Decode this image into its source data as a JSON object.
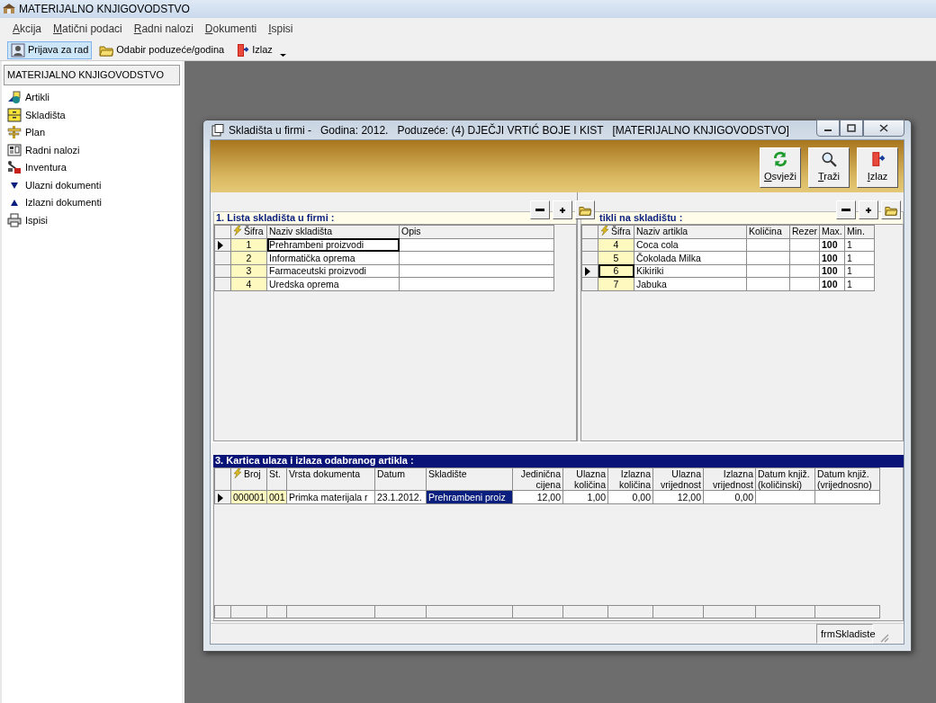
{
  "app": {
    "title": "MATERIJALNO KNJIGOVODSTVO"
  },
  "menu": [
    {
      "label": "Akcija"
    },
    {
      "label": "Matični podaci"
    },
    {
      "label": "Radni nalozi"
    },
    {
      "label": "Dokumenti"
    },
    {
      "label": "Ispisi"
    }
  ],
  "toolbar": [
    {
      "label": "Prijava za rad",
      "kind": "login",
      "selected": true
    },
    {
      "label": "Odabir poduzeće/godina",
      "kind": "folder",
      "selected": false
    },
    {
      "label": "Izlaz",
      "kind": "exit",
      "selected": false
    }
  ],
  "sidebar": {
    "title": "MATERIJALNO KNJIGOVODSTVO",
    "items": [
      {
        "label": "Artikli",
        "kind": "articles"
      },
      {
        "label": "Skladišta",
        "kind": "warehouse"
      },
      {
        "label": "Plan",
        "kind": "plan"
      },
      {
        "label": "Radni nalozi",
        "kind": "form"
      },
      {
        "label": "Inventura",
        "kind": "inventory"
      },
      {
        "label": "Ulazni dokumenti",
        "kind": "down"
      },
      {
        "label": "Izlazni dokumenti",
        "kind": "up"
      },
      {
        "label": "Ispisi",
        "kind": "print"
      }
    ]
  },
  "window": {
    "title": "Skladišta u firmi -   Godina: 2012.   Poduzeće: (4) DJEČJI VRTIĆ BOJE I KIST   [MATERIJALNO KNJIGOVODSTVO]",
    "actions": [
      {
        "label": "Osvježi",
        "kind": "refresh"
      },
      {
        "label": "Traži",
        "kind": "search"
      },
      {
        "label": "Izlaz",
        "kind": "exit"
      }
    ],
    "warehouses": {
      "title": "1. Lista skladišta u firmi  :",
      "columns": [
        {
          "label": "Šifra",
          "kind": "key"
        },
        {
          "label": "Naziv skladišta",
          "kind": "text"
        },
        {
          "label": "Opis",
          "kind": "text"
        }
      ],
      "rows": [
        {
          "current": true,
          "cells": [
            "1",
            "Prehrambeni proizvodi",
            null
          ],
          "focused": [
            false,
            true,
            false
          ]
        },
        {
          "current": false,
          "cells": [
            "2",
            "Informatička oprema",
            null
          ],
          "focused": [
            false,
            false,
            false
          ]
        },
        {
          "current": false,
          "cells": [
            "3",
            "Farmaceutski proizvodi",
            null
          ],
          "focused": [
            false,
            false,
            false
          ]
        },
        {
          "current": false,
          "cells": [
            "4",
            "Uredska oprema",
            null
          ],
          "focused": [
            false,
            false,
            false
          ]
        }
      ]
    },
    "articles": {
      "title": "tikli na skladištu  :",
      "columns": [
        {
          "label": "Šifra",
          "kind": "key"
        },
        {
          "label": "Naziv artikla",
          "kind": "text"
        },
        {
          "label": "Količina",
          "kind": "text"
        },
        {
          "label": "Rezer",
          "kind": "text"
        },
        {
          "label": "Max.",
          "kind": "bold"
        },
        {
          "label": "Min.",
          "kind": "text"
        }
      ],
      "rows": [
        {
          "current": false,
          "cells": [
            "4",
            "Coca cola",
            null,
            null,
            "100",
            "1"
          ],
          "focused": [
            false,
            false,
            false,
            false,
            false,
            false
          ]
        },
        {
          "current": false,
          "cells": [
            "5",
            "Čokolada Milka",
            null,
            null,
            "100",
            "1"
          ],
          "focused": [
            false,
            false,
            false,
            false,
            false,
            false
          ]
        },
        {
          "current": true,
          "cells": [
            "6",
            "Kikiriki",
            null,
            null,
            "100",
            "1"
          ],
          "focused": [
            true,
            false,
            false,
            false,
            false,
            false
          ]
        },
        {
          "current": false,
          "cells": [
            "7",
            "Jabuka",
            null,
            null,
            "100",
            "1"
          ],
          "focused": [
            false,
            false,
            false,
            false,
            false,
            false
          ]
        }
      ]
    },
    "card": {
      "title": "3. Kartica ulaza i izlaza odabranog artikla :",
      "columns": [
        {
          "label": "Broj",
          "kind": "key"
        },
        {
          "label": "St.",
          "kind": "code"
        },
        {
          "label": "Vrsta dokumenta",
          "kind": "text"
        },
        {
          "label": "Datum",
          "kind": "text"
        },
        {
          "label": "Skladište",
          "kind": "text"
        },
        {
          "label": "Jedinična\ncijena",
          "kind": "number"
        },
        {
          "label": "Ulazna\nkoličina",
          "kind": "number"
        },
        {
          "label": "Izlazna\nkoličina",
          "kind": "number"
        },
        {
          "label": "Ulazna\nvrijednost",
          "kind": "number"
        },
        {
          "label": "Izlazna\nvrijednost",
          "kind": "number"
        },
        {
          "label": "Datum knjiž.\n(količinski)",
          "kind": "text"
        },
        {
          "label": "Datum knjiž.\n(vrijednosno)",
          "kind": "text"
        }
      ],
      "rows": [
        {
          "current": true,
          "cells": [
            "000001",
            "001",
            "Primka materijala r",
            "23.1.2012.",
            "Prehrambeni proiz",
            "12,00",
            "1,00",
            "0,00",
            "12,00",
            "0,00",
            null,
            null
          ],
          "focused": [
            false,
            false,
            false,
            false,
            true,
            false,
            false,
            false,
            false,
            false,
            false,
            false
          ]
        }
      ]
    },
    "status": "frmSkladiste"
  }
}
